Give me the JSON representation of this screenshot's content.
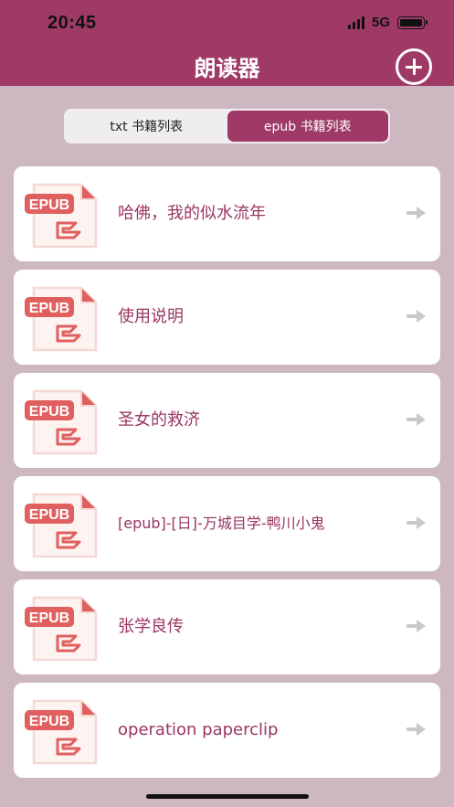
{
  "status_bar": {
    "time": "20:45",
    "network": "5G",
    "signal_icon": "signal-bars-icon",
    "battery_icon": "battery-full-icon"
  },
  "header": {
    "title": "朗读器",
    "add_icon": "plus-circle-icon"
  },
  "tabs": [
    {
      "label": "txt 书籍列表",
      "active": false
    },
    {
      "label": "epub 书籍列表",
      "active": true
    }
  ],
  "books": [
    {
      "title": "哈佛，我的似水流年",
      "icon": "epub-file-icon",
      "arrow": "arrow-right-icon"
    },
    {
      "title": "使用说明",
      "icon": "epub-file-icon",
      "arrow": "arrow-right-icon"
    },
    {
      "title": "圣女的救济",
      "icon": "epub-file-icon",
      "arrow": "arrow-right-icon"
    },
    {
      "title": "[epub]-[日]-万城目学-鸭川小鬼",
      "icon": "epub-file-icon",
      "arrow": "arrow-right-icon"
    },
    {
      "title": "张学良传",
      "icon": "epub-file-icon",
      "arrow": "arrow-right-icon"
    },
    {
      "title": "operation paperclip",
      "icon": "epub-file-icon",
      "arrow": "arrow-right-icon"
    }
  ],
  "epub_badge_text": "EPUB",
  "colors": {
    "accent": "#9f3a66",
    "background": "#cdb8c2",
    "icon_red": "#e0605f",
    "icon_pink": "#f4d8d3"
  }
}
